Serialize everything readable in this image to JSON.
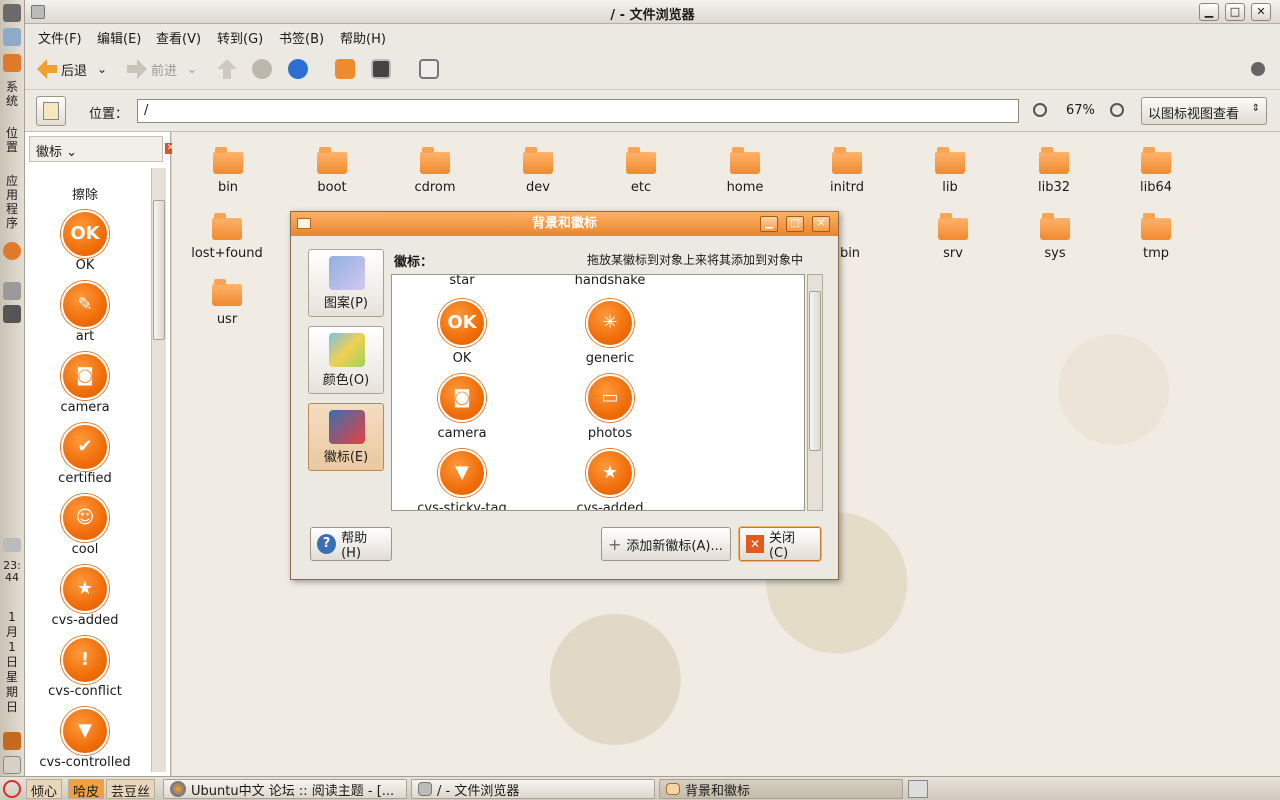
{
  "window": {
    "title": "/ - 文件浏览器"
  },
  "left_panel": {
    "system": "系统",
    "places": "位置",
    "apps": "应用程序",
    "clock": "23:44",
    "date": "1月1日星期日"
  },
  "menubar": [
    "文件(F)",
    "编辑(E)",
    "查看(V)",
    "转到(G)",
    "书签(B)",
    "帮助(H)"
  ],
  "toolbar": {
    "back": "后退",
    "forward": "前进"
  },
  "location": {
    "label": "位置：",
    "path": "/",
    "zoom": "67%",
    "view_mode": "以图标视图查看"
  },
  "sidebar": {
    "selector": "徽标",
    "top_partial": "擦除",
    "items": [
      "OK",
      "art",
      "camera",
      "certified",
      "cool",
      "cvs-added",
      "cvs-conflict",
      "cvs-controlled"
    ]
  },
  "files": {
    "row1": [
      "bin",
      "boot",
      "cdrom",
      "dev",
      "etc",
      "home",
      "initrd",
      "lib",
      "lib32",
      "lib64"
    ],
    "row2_left": "lost+found",
    "row2_right": [
      "bin",
      "srv",
      "sys",
      "tmp"
    ],
    "row3": "usr"
  },
  "dialog": {
    "title": "背景和徽标",
    "categories": [
      "图案(P)",
      "颜色(O)",
      "徽标(E)"
    ],
    "section_label": "徽标：",
    "hint": "拖放某徽标到对象上来将其添加到对象中",
    "top_labels": [
      "star",
      "handshake"
    ],
    "emblems": [
      "OK",
      "generic",
      "camera",
      "photos",
      "cvs-sticky-tag",
      "cvs-added"
    ],
    "help_button": "帮助(H)",
    "add_button": "添加新徽标(A)...",
    "close_button": "关闭(C)"
  },
  "taskbar": {
    "workspaces": [
      "倾心",
      "哈皮",
      "芸豆丝"
    ],
    "tasks": [
      "Ubuntu中文 论坛 :: 阅读主题 - [...",
      "/ - 文件浏览器",
      "背景和徽标"
    ]
  }
}
